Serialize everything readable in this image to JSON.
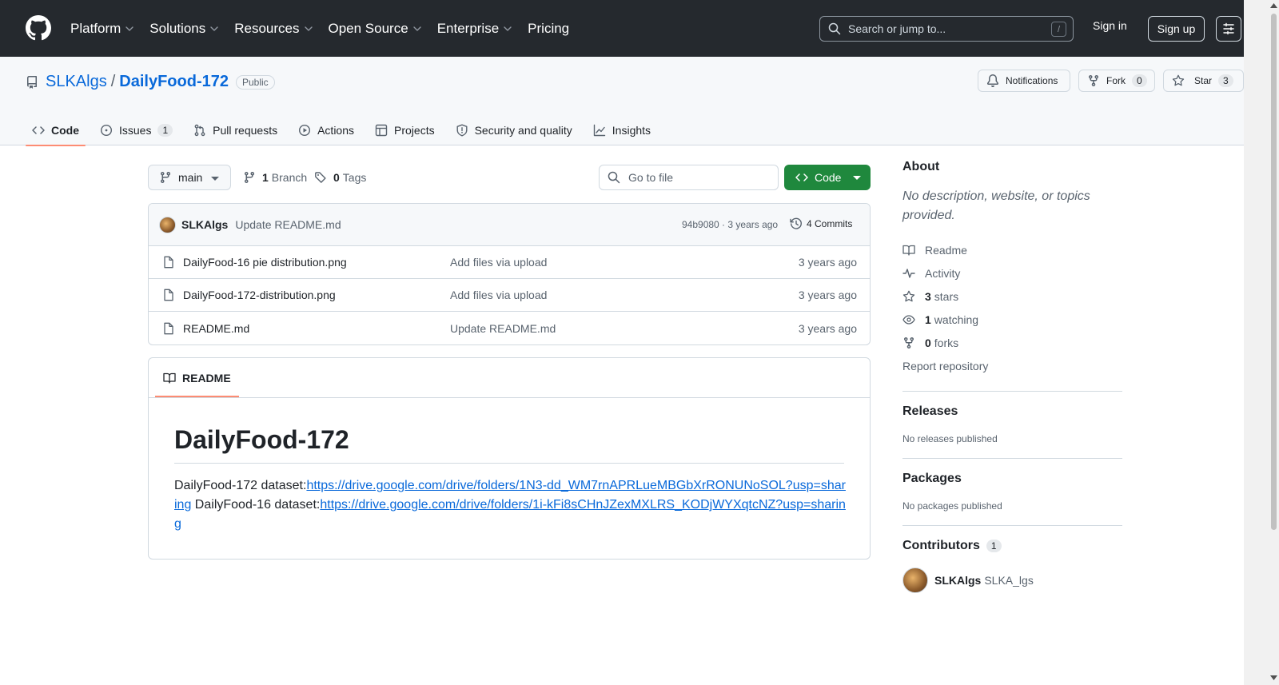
{
  "header": {
    "nav": [
      {
        "label": "Platform",
        "has_menu": true
      },
      {
        "label": "Solutions",
        "has_menu": true
      },
      {
        "label": "Resources",
        "has_menu": true
      },
      {
        "label": "Open Source",
        "has_menu": true
      },
      {
        "label": "Enterprise",
        "has_menu": true
      },
      {
        "label": "Pricing",
        "has_menu": false
      }
    ],
    "search_placeholder": "Search or jump to...",
    "search_shortcut": "/",
    "sign_in": "Sign in",
    "sign_up": "Sign up"
  },
  "repo": {
    "owner": "SLKAlgs",
    "separator": "/",
    "name": "DailyFood-172",
    "visibility": "Public",
    "notifications_label": "Notifications",
    "fork_label": "Fork",
    "fork_count": "0",
    "star_label": "Star",
    "star_count": "3"
  },
  "tabs": [
    {
      "label": "Code",
      "icon": "code-icon",
      "active": true
    },
    {
      "label": "Issues",
      "icon": "issue-icon",
      "count": "1"
    },
    {
      "label": "Pull requests",
      "icon": "pull-request-icon"
    },
    {
      "label": "Actions",
      "icon": "play-icon"
    },
    {
      "label": "Projects",
      "icon": "table-icon"
    },
    {
      "label": "Security and quality",
      "icon": "shield-icon"
    },
    {
      "label": "Insights",
      "icon": "graph-icon"
    }
  ],
  "toolbar": {
    "branch": "main",
    "branch_count": "1",
    "branch_label": "Branch",
    "tag_count": "0",
    "tag_label": "Tags",
    "goto_placeholder": "Go to file",
    "code_button": "Code"
  },
  "latest_commit": {
    "author": "SLKAlgs",
    "message": "Update README.md",
    "hash_time": "94b9080 · 3 years ago",
    "commits": "4 Commits"
  },
  "files": [
    {
      "name": "DailyFood-16 pie distribution.png",
      "message": "Add files via upload",
      "time": "3 years ago"
    },
    {
      "name": "DailyFood-172-distribution.png",
      "message": "Add files via upload",
      "time": "3 years ago"
    },
    {
      "name": "README.md",
      "message": "Update README.md",
      "time": "3 years ago"
    }
  ],
  "readme": {
    "tab_label": "README",
    "title": "DailyFood-172",
    "line1_text": "DailyFood-172 dataset:",
    "line1_link": "https://drive.google.com/drive/folders/1N3-dd_WM7rnAPRLueMBGbXrRONUNoSOL?usp=sharing",
    "line2_text": " DailyFood-16 dataset:",
    "line2_link": "https://drive.google.com/drive/folders/1i-kFi8sCHnJZexMXLRS_KODjWYXqtcNZ?usp=sharing"
  },
  "sidebar": {
    "about_title": "About",
    "about_desc": "No description, website, or topics provided.",
    "links": [
      {
        "icon": "book-icon",
        "value": "",
        "label": "Readme"
      },
      {
        "icon": "pulse-icon",
        "value": "",
        "label": "Activity"
      },
      {
        "icon": "star-icon",
        "value": "3",
        "label": "stars"
      },
      {
        "icon": "eye-icon",
        "value": "1",
        "label": "watching"
      },
      {
        "icon": "fork-icon",
        "value": "0",
        "label": "forks"
      }
    ],
    "report": "Report repository",
    "releases_title": "Releases",
    "releases_text": "No releases published",
    "packages_title": "Packages",
    "packages_text": "No packages published",
    "contributors_title": "Contributors",
    "contributors_count": "1",
    "contributor_login": "SLKAlgs",
    "contributor_name": "SLKA_lgs"
  },
  "colors": {
    "header_bg": "#25292e",
    "link": "#0969da",
    "primary_button": "#1f883d",
    "active_tab_underline": "#fd8c73"
  }
}
